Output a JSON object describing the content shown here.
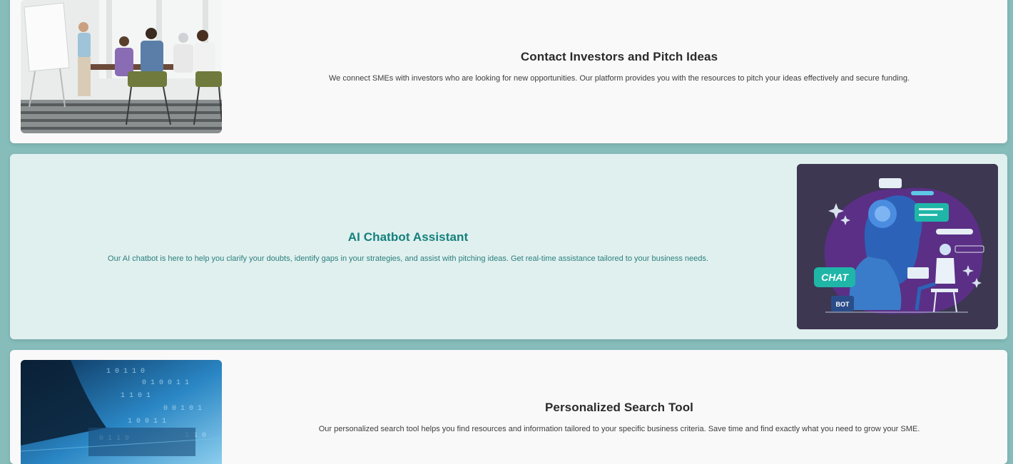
{
  "features": [
    {
      "title": "Contact Investors and Pitch Ideas",
      "description": "We connect SMEs with investors who are looking for new opportunities. Our platform provides you with the resources to pitch your ideas effectively and secure funding."
    },
    {
      "title": "AI Chatbot Assistant",
      "description": "Our AI chatbot is here to help you clarify your doubts, identify gaps in your strategies, and assist with pitching ideas. Get real-time assistance tailored to your business needs.",
      "image_labels": {
        "chat": "CHAT",
        "bot": "BOT"
      }
    },
    {
      "title": "Personalized Search Tool",
      "description": "Our personalized search tool helps you find resources and information tailored to your specific business criteria. Save time and find exactly what you need to grow your SME."
    }
  ],
  "colors": {
    "page_background": "#86bdbb",
    "card_light": "#f9f9f9",
    "card_teal": "#e0f0ef",
    "accent_teal": "#14807c",
    "chat_badge": "#1fb6a8"
  }
}
